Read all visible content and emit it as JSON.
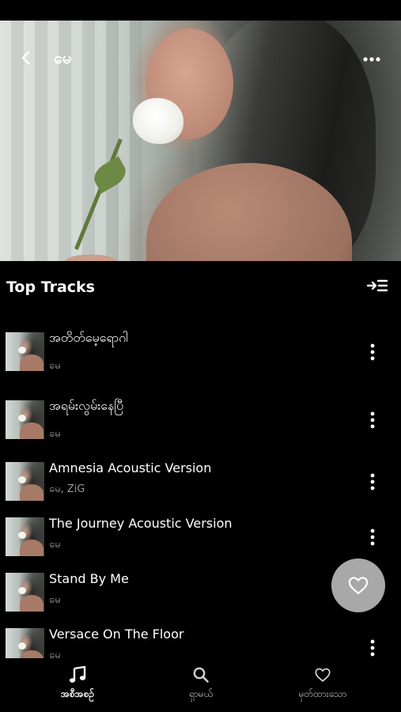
{
  "header": {
    "artist_name": "မေ"
  },
  "top_tracks": {
    "title": "Top Tracks",
    "tracks": [
      {
        "title": "အတိတ်မေ့ရောဂါ",
        "artist": "မေ"
      },
      {
        "title": "အရမ်းလွမ်းနေပြီ",
        "artist": "မေ"
      },
      {
        "title": "Amnesia Acoustic Version",
        "artist": "မေ, ZiG"
      },
      {
        "title": "The Journey Acoustic Version",
        "artist": "မေ"
      },
      {
        "title": "Stand By Me",
        "artist": "မေ"
      },
      {
        "title": "Versace On The Floor",
        "artist": "မေ"
      }
    ]
  },
  "bottom_nav": {
    "items": [
      {
        "label": "အစီအစဉ်",
        "icon": "music-note-icon",
        "active": true
      },
      {
        "label": "ရှာမယ်",
        "icon": "search-icon",
        "active": false
      },
      {
        "label": "မှတ်ထားသော",
        "icon": "heart-outline-icon",
        "active": false
      }
    ]
  },
  "colors": {
    "background": "#000000",
    "primary_text": "#ffffff",
    "secondary_text": "#9a9a9a",
    "fab_background": "#a8a8a8"
  }
}
